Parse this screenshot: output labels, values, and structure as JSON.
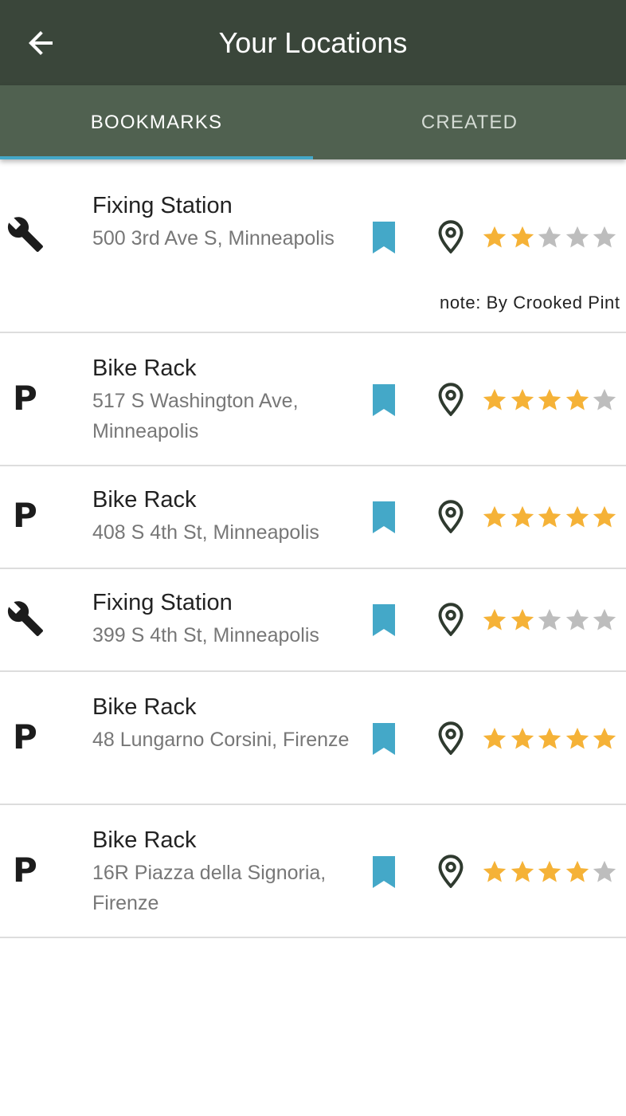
{
  "appbar": {
    "title": "Your Locations",
    "back_icon": "arrow-left-icon"
  },
  "tabs": [
    {
      "label": "BOOKMARKS",
      "active": true
    },
    {
      "label": "CREATED",
      "active": false
    }
  ],
  "colors": {
    "appbar": "#3a463a",
    "tabbar": "#506150",
    "accent": "#44a8c8",
    "star_filled": "#f5b237",
    "star_empty": "#bdbdbd"
  },
  "locations": [
    {
      "type": "fixing-station",
      "type_icon": "wrench-icon",
      "name": "Fixing Station",
      "address": "500 3rd Ave S, Minneapolis",
      "rating": 2,
      "note": "note: By Crooked Pint"
    },
    {
      "type": "bike-rack",
      "type_icon": "parking-icon",
      "icon_text": "P",
      "name": "Bike Rack",
      "address": "517 S Washington Ave, Minneapolis",
      "rating": 4
    },
    {
      "type": "bike-rack",
      "type_icon": "parking-icon",
      "icon_text": "P",
      "name": "Bike Rack",
      "address": "408 S 4th St, Minneapolis",
      "rating": 5
    },
    {
      "type": "fixing-station",
      "type_icon": "wrench-icon",
      "name": "Fixing Station",
      "address": "399 S 4th St, Minneapolis",
      "rating": 2
    },
    {
      "type": "bike-rack",
      "type_icon": "parking-icon",
      "icon_text": "P",
      "name": "Bike Rack",
      "address": "48 Lungarno Corsini, Firenze",
      "rating": 5
    },
    {
      "type": "bike-rack",
      "type_icon": "parking-icon",
      "icon_text": "P",
      "name": "Bike Rack",
      "address": "16R Piazza della Signoria, Firenze",
      "rating": 4
    }
  ]
}
